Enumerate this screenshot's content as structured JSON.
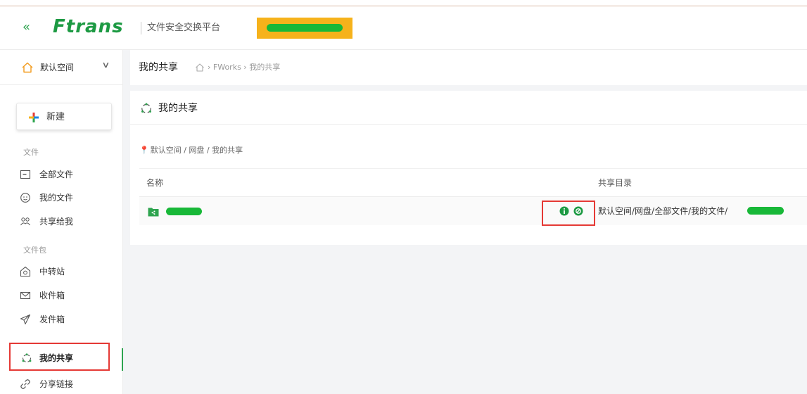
{
  "header": {
    "collapse_glyph": "«",
    "logo_text": "Ftrans",
    "platform_title": "文件安全交换平台"
  },
  "sidebar": {
    "space_label": "默认空间",
    "chevron_glyph": "∨",
    "new_label": "新建",
    "section_files": "文件",
    "section_package": "文件包",
    "items": [
      {
        "label": "全部文件",
        "icon": "folder-icon"
      },
      {
        "label": "我的文件",
        "icon": "person-face-icon"
      },
      {
        "label": "共享给我",
        "icon": "share-people-icon"
      },
      {
        "label": "中转站",
        "icon": "transfer-station-icon"
      },
      {
        "label": "收件箱",
        "icon": "inbox-mail-icon"
      },
      {
        "label": "发件箱",
        "icon": "paper-plane-icon"
      },
      {
        "label": "我的共享",
        "icon": "share-circle-icon",
        "active": true
      },
      {
        "label": "分享链接",
        "icon": "link-icon"
      }
    ]
  },
  "breadcrumb": {
    "title": "我的共享",
    "path": "› FWorks › 我的共享"
  },
  "card": {
    "title": "我的共享",
    "location_pin": "📍",
    "location": "默认空间 / 网盘 / 我的共享",
    "columns": [
      "名称",
      "共享目录"
    ],
    "rows": [
      {
        "share_dir_prefix": "默认空间/网盘/全部文件/我的文件/"
      }
    ]
  },
  "colors": {
    "brand_green": "#1d9a43",
    "highlight_red": "#e53935",
    "badge_orange": "#f6b21b"
  }
}
